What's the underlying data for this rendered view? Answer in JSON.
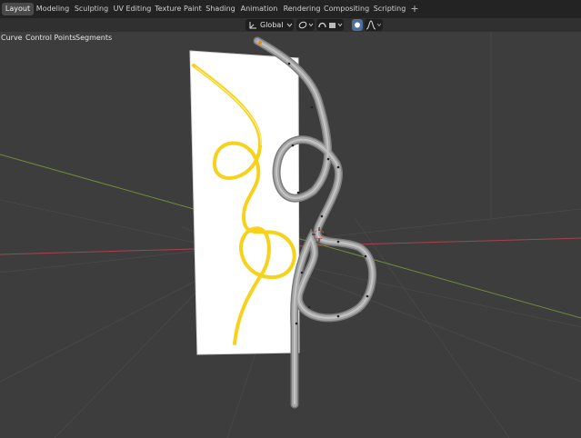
{
  "workspace_tabs": [
    {
      "label": "Layout",
      "active": true
    },
    {
      "label": "Modeling",
      "active": false
    },
    {
      "label": "Sculpting",
      "active": false
    },
    {
      "label": "UV Editing",
      "active": false
    },
    {
      "label": "Texture Paint",
      "active": false
    },
    {
      "label": "Shading",
      "active": false
    },
    {
      "label": "Animation",
      "active": false
    },
    {
      "label": "Rendering",
      "active": false
    },
    {
      "label": "Compositing",
      "active": false
    },
    {
      "label": "Scripting",
      "active": false
    }
  ],
  "add_workspace_label": "+",
  "toolbar": {
    "transform_orientation": "Global",
    "pivot_icon": "transform-pivot-icon",
    "snap_icon": "snap-link-icon",
    "proportional_icon": "proportional-edit-icon",
    "falloff_icon": "falloff-curve-icon"
  },
  "viewport_menu": {
    "items": [
      "Curve",
      "Control Points",
      "Segments"
    ]
  },
  "colors": {
    "topbar": "#232323",
    "viewport_bg": "#3d3d3d",
    "grid_x_axis": "#a8424e",
    "grid_y_axis": "#6d8d3a",
    "image_plane": "#ffffff",
    "straw_yellow": "#f6d21a",
    "curve_tube": "#9a9a9a"
  }
}
